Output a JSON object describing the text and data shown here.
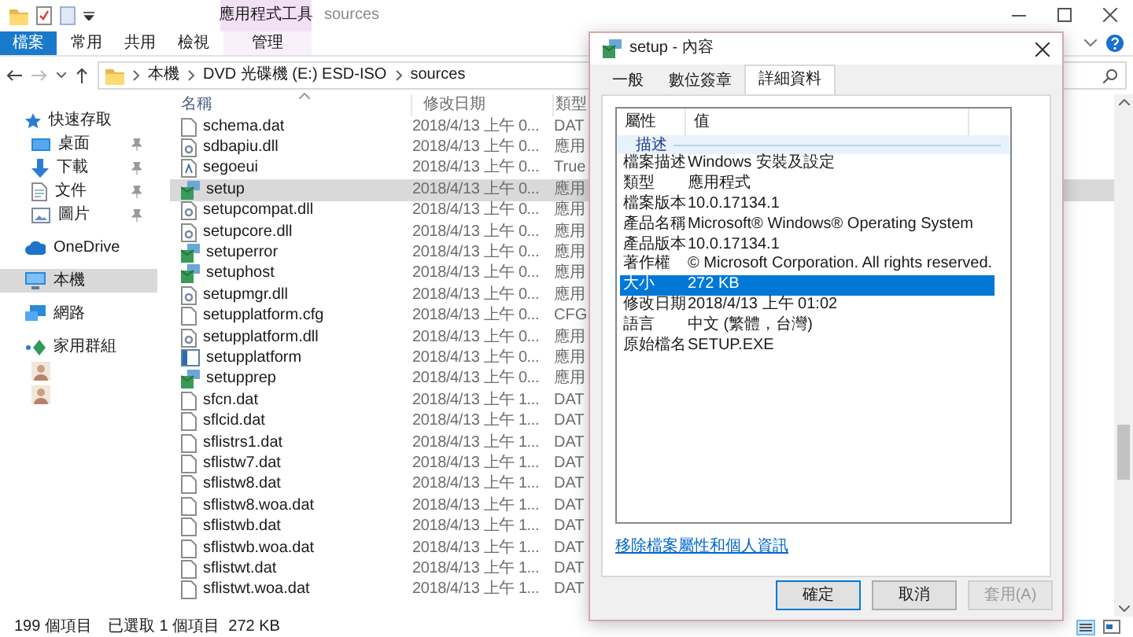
{
  "explorer": {
    "context_group": "應用程式工具",
    "title": "sources",
    "ribbon_tabs": [
      {
        "label": "檔案",
        "kind": "file"
      },
      {
        "label": "常用",
        "kind": "normal"
      },
      {
        "label": "共用",
        "kind": "normal"
      },
      {
        "label": "檢視",
        "kind": "normal"
      },
      {
        "label": "管理",
        "kind": "context"
      }
    ],
    "breadcrumb": [
      "本機",
      "DVD 光碟機 (E:) ESD-ISO",
      "sources"
    ],
    "sidebar": [
      {
        "label": "快速存取",
        "selected": false,
        "children": [
          {
            "label": "桌面",
            "pinned": true,
            "selected": false
          },
          {
            "label": "下載",
            "pinned": true,
            "selected": false
          },
          {
            "label": "文件",
            "pinned": true,
            "selected": false
          },
          {
            "label": "圖片",
            "pinned": true,
            "selected": false
          }
        ]
      },
      {
        "label": "OneDrive",
        "selected": false
      },
      {
        "label": "本機",
        "selected": true
      },
      {
        "label": "網路",
        "selected": false
      },
      {
        "label": "家用群組",
        "selected": false,
        "children": [
          {
            "selected": false
          },
          {
            "selected": false
          }
        ]
      }
    ],
    "columns": [
      "名稱",
      "修改日期",
      "類型"
    ],
    "files": [
      {
        "name": "schema.dat",
        "kind": "blank",
        "date": "2018/4/13 上午 0...",
        "type": "DAT",
        "selected": false
      },
      {
        "name": "sdbapiu.dll",
        "kind": "dll",
        "date": "2018/4/13 上午 0...",
        "type": "應用",
        "selected": false
      },
      {
        "name": "segoeui",
        "kind": "font",
        "date": "2018/4/13 上午 0...",
        "type": "True",
        "selected": false
      },
      {
        "name": "setup",
        "kind": "setup",
        "date": "2018/4/13 上午 0...",
        "type": "應用",
        "selected": true
      },
      {
        "name": "setupcompat.dll",
        "kind": "dll",
        "date": "2018/4/13 上午 0...",
        "type": "應用",
        "selected": false
      },
      {
        "name": "setupcore.dll",
        "kind": "dll",
        "date": "2018/4/13 上午 0...",
        "type": "應用",
        "selected": false
      },
      {
        "name": "setuperror",
        "kind": "setup",
        "date": "2018/4/13 上午 0...",
        "type": "應用",
        "selected": false
      },
      {
        "name": "setuphost",
        "kind": "setup",
        "date": "2018/4/13 上午 0...",
        "type": "應用",
        "selected": false
      },
      {
        "name": "setupmgr.dll",
        "kind": "dll",
        "date": "2018/4/13 上午 0...",
        "type": "應用",
        "selected": false
      },
      {
        "name": "setupplatform.cfg",
        "kind": "blank",
        "date": "2018/4/13 上午 0...",
        "type": "CFG",
        "selected": false
      },
      {
        "name": "setupplatform.dll",
        "kind": "dll",
        "date": "2018/4/13 上午 0...",
        "type": "應用",
        "selected": false
      },
      {
        "name": "setupplatform",
        "kind": "app",
        "date": "2018/4/13 上午 0...",
        "type": "應用",
        "selected": false
      },
      {
        "name": "setupprep",
        "kind": "setup",
        "date": "2018/4/13 上午 0...",
        "type": "應用",
        "selected": false
      },
      {
        "name": "sfcn.dat",
        "kind": "blank",
        "date": "2018/4/13 上午 1...",
        "type": "DAT",
        "selected": false
      },
      {
        "name": "sflcid.dat",
        "kind": "blank",
        "date": "2018/4/13 上午 1...",
        "type": "DAT",
        "selected": false
      },
      {
        "name": "sflistrs1.dat",
        "kind": "blank",
        "date": "2018/4/13 上午 1...",
        "type": "DAT",
        "selected": false
      },
      {
        "name": "sflistw7.dat",
        "kind": "blank",
        "date": "2018/4/13 上午 1...",
        "type": "DAT",
        "selected": false
      },
      {
        "name": "sflistw8.dat",
        "kind": "blank",
        "date": "2018/4/13 上午 1...",
        "type": "DAT",
        "selected": false
      },
      {
        "name": "sflistw8.woa.dat",
        "kind": "blank",
        "date": "2018/4/13 上午 1...",
        "type": "DAT",
        "selected": false
      },
      {
        "name": "sflistwb.dat",
        "kind": "blank",
        "date": "2018/4/13 上午 1...",
        "type": "DAT",
        "selected": false
      },
      {
        "name": "sflistwb.woa.dat",
        "kind": "blank",
        "date": "2018/4/13 上午 1...",
        "type": "DAT",
        "selected": false
      },
      {
        "name": "sflistwt.dat",
        "kind": "blank",
        "date": "2018/4/13 上午 1...",
        "type": "DAT",
        "selected": false
      },
      {
        "name": "sflistwt.woa.dat",
        "kind": "blank",
        "date": "2018/4/13 上午 1...",
        "type": "DAT",
        "selected": false
      }
    ],
    "status_bar": {
      "item_count": "199 個項目",
      "selection": "已選取 1 個項目  272 KB"
    }
  },
  "dialog": {
    "title": "setup - 內容",
    "tabs": [
      {
        "label": "一般",
        "selected": false
      },
      {
        "label": "數位簽章",
        "selected": false
      },
      {
        "label": "詳細資料",
        "selected": true
      }
    ],
    "columns": [
      "屬性",
      "值"
    ],
    "properties": [
      {
        "kind": "group",
        "label": "描述"
      },
      {
        "kind": "property",
        "label": "檔案描述",
        "value": "Windows 安裝及設定",
        "selected": false
      },
      {
        "kind": "property",
        "label": "類型",
        "value": "應用程式",
        "selected": false
      },
      {
        "kind": "property",
        "label": "檔案版本",
        "value": "10.0.17134.1",
        "selected": false
      },
      {
        "kind": "property",
        "label": "產品名稱",
        "value": "Microsoft® Windows® Operating System",
        "selected": false
      },
      {
        "kind": "property",
        "label": "產品版本",
        "value": "10.0.17134.1",
        "selected": false
      },
      {
        "kind": "property",
        "label": "著作權",
        "value": "© Microsoft Corporation. All rights reserved.",
        "selected": false
      },
      {
        "kind": "property",
        "label": "大小",
        "value": "272 KB",
        "selected": true
      },
      {
        "kind": "property",
        "label": "修改日期",
        "value": "2018/4/13 上午 01:02",
        "selected": false
      },
      {
        "kind": "property",
        "label": "語言",
        "value": "中文 (繁體，台灣)",
        "selected": false
      },
      {
        "kind": "property",
        "label": "原始檔名",
        "value": "SETUP.EXE",
        "selected": false
      }
    ],
    "link": "移除檔案屬性和個人資訊",
    "buttons": [
      {
        "label": "確定",
        "default": true,
        "disabled": false
      },
      {
        "label": "取消",
        "default": false,
        "disabled": false
      },
      {
        "label": "套用(A)",
        "default": false,
        "disabled": true
      }
    ]
  }
}
